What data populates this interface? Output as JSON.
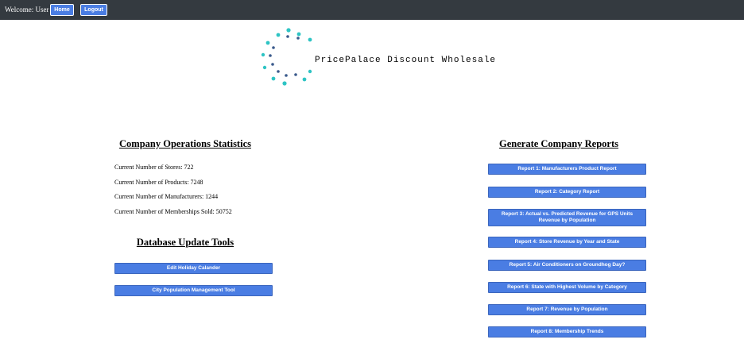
{
  "header": {
    "welcome": "Welcome: User",
    "home_label": "Home",
    "logout_label": "Logout"
  },
  "brand": {
    "name": "PricePalace Discount Wholesale",
    "logo_colors": [
      "#2ec4c4",
      "#3a5a8c"
    ]
  },
  "stats": {
    "title": "Company Operations Statistics",
    "items": [
      "Current Number of Stores: 722",
      "Current Number of Products: 7248",
      "Current Number of Manufacturers: 1244",
      "Current Number of Memberships Sold: 50752"
    ]
  },
  "tools": {
    "title": "Database Update Tools",
    "buttons": [
      "Edit Holiday Calander",
      "City Population Management Tool"
    ]
  },
  "reports": {
    "title": "Generate Company Reports",
    "buttons": [
      "Report 1: Manufacturers Product Report",
      "Report 2: Category Report",
      "Report 3: Actual vs. Predicted Revenue for GPS Units Revenue by Population",
      "Report 4: Store Revenue by Year and State",
      "Report 5: Air Conditioners on Groundhog Day?",
      "Report 6: State with Highest Volume by Category",
      "Report 7: Revenue by Population",
      "Report 8: Membership Trends"
    ]
  }
}
